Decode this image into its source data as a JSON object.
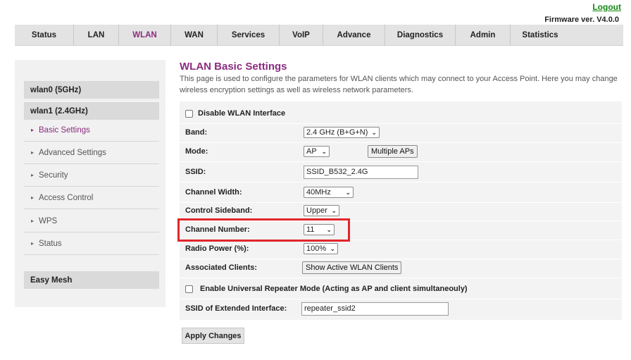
{
  "header": {
    "logout_label": "Logout",
    "firmware_label": "Firmware ver. V4.0.0"
  },
  "nav": {
    "tabs": [
      {
        "label": "Status"
      },
      {
        "label": "LAN"
      },
      {
        "label": "WLAN",
        "active": true
      },
      {
        "label": "WAN"
      },
      {
        "label": "Services"
      },
      {
        "label": "VoIP"
      },
      {
        "label": "Advance"
      },
      {
        "label": "Diagnostics"
      },
      {
        "label": "Admin"
      },
      {
        "label": "Statistics"
      }
    ]
  },
  "sidebar": {
    "groups": [
      "wlan0 (5GHz)",
      "wlan1 (2.4GHz)"
    ],
    "items": [
      {
        "label": "Basic Settings",
        "active": true
      },
      {
        "label": "Advanced Settings"
      },
      {
        "label": "Security"
      },
      {
        "label": "Access Control"
      },
      {
        "label": "WPS"
      },
      {
        "label": "Status"
      }
    ],
    "easy_mesh": "Easy Mesh"
  },
  "page": {
    "title": "WLAN Basic Settings",
    "description": "This page is used to configure the parameters for WLAN clients which may connect to your Access Point. Here you may change wireless encryption settings as well as wireless network parameters."
  },
  "form": {
    "disable_wlan_label": "Disable WLAN Interface",
    "band": {
      "label": "Band:",
      "value": "2.4 GHz (B+G+N)"
    },
    "mode": {
      "label": "Mode:",
      "value": "AP",
      "button": "Multiple APs"
    },
    "ssid": {
      "label": "SSID:",
      "value": "SSID_B532_2.4G"
    },
    "channel_width": {
      "label": "Channel Width:",
      "value": "40MHz"
    },
    "control_sideband": {
      "label": "Control Sideband:",
      "value": "Upper"
    },
    "channel_number": {
      "label": "Channel Number:",
      "value": "11"
    },
    "radio_power": {
      "label": "Radio Power (%):",
      "value": "100%"
    },
    "associated_clients": {
      "label": "Associated Clients:",
      "button": "Show Active WLAN Clients"
    },
    "repeater_label": "Enable Universal Repeater Mode (Acting as AP and client simultaneouly)",
    "extended_ssid": {
      "label": "SSID of Extended Interface:",
      "value": "repeater_ssid2"
    },
    "apply_label": "Apply Changes"
  },
  "colors": {
    "accent": "#8b2c7e",
    "highlight": "#e0262b",
    "logout": "#118811"
  }
}
